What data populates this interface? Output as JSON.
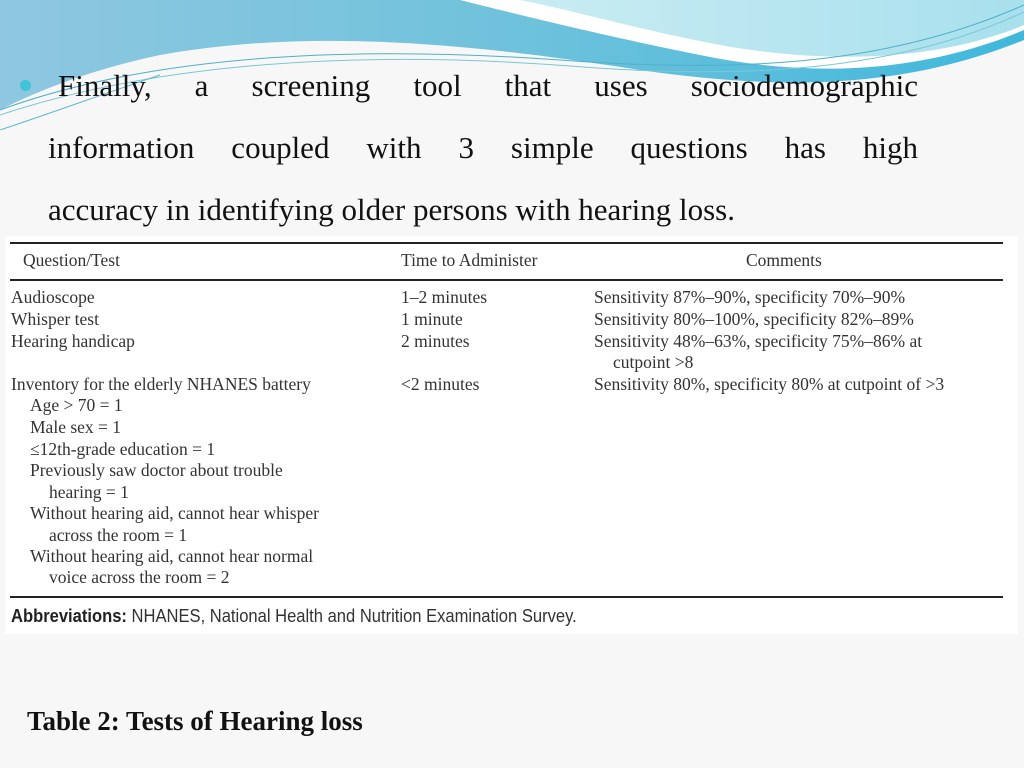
{
  "slide": {
    "bullet_lines": [
      "Finally, a screening tool that uses sociodemographic",
      "information coupled with 3 simple questions has high",
      "accuracy in identifying older persons with hearing loss."
    ],
    "accent_color": "#3fc4d8"
  },
  "table": {
    "headers": [
      "Question/Test",
      "Time to Administer",
      "Comments"
    ],
    "rows": [
      {
        "test": "Audioscope",
        "time": "1–2 minutes",
        "comment": "Sensitivity 87%–90%, specificity 70%–90%"
      },
      {
        "test": "Whisper test",
        "time": "1 minute",
        "comment": "Sensitivity 80%–100%, specificity 82%–89%"
      },
      {
        "test": "Hearing handicap",
        "time": "2 minutes",
        "comment": "Sensitivity 48%–63%, specificity 75%–86% at",
        "comment_cont": "cutpoint >8"
      },
      {
        "test": "Inventory for the elderly NHANES battery",
        "time": "<2 minutes",
        "comment": "Sensitivity 80%, specificity 80% at cutpoint of >3"
      }
    ],
    "nhanes_items": [
      "Age > 70 = 1",
      "Male sex = 1",
      "≤12th-grade education = 1",
      "Previously saw doctor about trouble",
      "hearing = 1",
      "Without hearing aid, cannot hear whisper",
      "across the room = 1",
      "Without hearing aid, cannot hear normal",
      "voice across the room = 2"
    ],
    "abbreviations_label": "Abbreviations:",
    "abbreviations_text": " NHANES, National Health and Nutrition Examination Survey."
  },
  "caption": "Table 2: Tests of Hearing loss"
}
